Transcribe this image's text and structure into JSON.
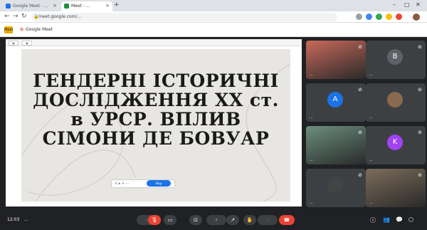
{
  "browser": {
    "tabs": [
      {
        "label": "Google Meet - ...",
        "color": "#1a73e8",
        "active": false
      },
      {
        "label": "Meet - ...",
        "color": "#1e8e3e",
        "active": true
      }
    ],
    "new_tab_label": "+",
    "url": "meet.google.com/...",
    "bookmark": "Google Meet"
  },
  "slide": {
    "title_lines": [
      "ГЕНДЕРНІ ІСТОРИЧНІ",
      "ДОСЛІДЖЕННЯ ХХ ст.",
      "в УРСР. ВПЛИВ",
      "СІМОНИ ДЕ БОВУАР"
    ],
    "controls_label": "< ▸ > ⋯",
    "blue_button": "Stop"
  },
  "participants": [
    {
      "name": "...",
      "initial": "",
      "color": "#c9695a",
      "video": true
    },
    {
      "name": "...",
      "initial": "B",
      "color": "#5f6368",
      "video": false
    },
    {
      "name": "...",
      "initial": "A",
      "color": "#1a73e8",
      "video": false
    },
    {
      "name": "...",
      "initial": "",
      "color": "#8a6a4f",
      "video": false
    },
    {
      "name": "...",
      "initial": "",
      "color": "#6b8f7e",
      "video": true
    },
    {
      "name": "...",
      "initial": "K",
      "color": "#a142f4",
      "video": false
    },
    {
      "name": "...",
      "initial": "",
      "color": "#444",
      "video": false
    },
    {
      "name": "...",
      "initial": "",
      "color": "#7d6c5a",
      "video": true
    }
  ],
  "bottombar": {
    "time": "12:03",
    "meeting_code": "..."
  },
  "colors": {
    "accent": "#1a73e8",
    "hangup": "#ea4335"
  }
}
